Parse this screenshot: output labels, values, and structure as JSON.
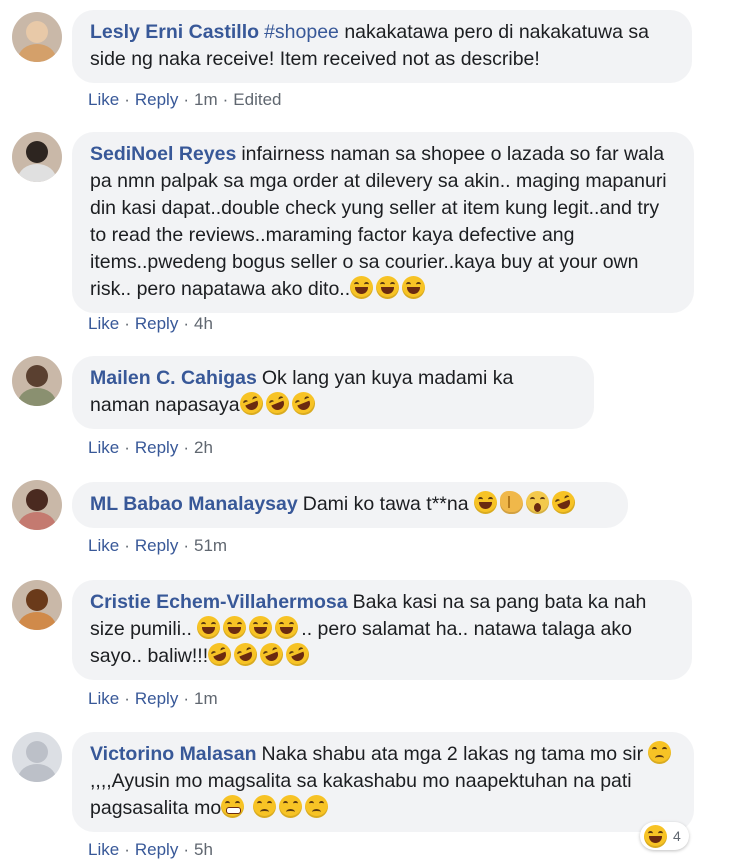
{
  "comments": [
    {
      "author": "Lesly Erni Castillo",
      "hashtag": "#shopee",
      "text": "nakakatawa pero di nakakatuwa sa side ng naka receive! Item received not as describe!",
      "like": "Like",
      "reply": "Reply",
      "time": "1m",
      "edited": "Edited",
      "avatar_colors": [
        "#e8c9a8",
        "#d4a06a",
        "#a87b4f"
      ]
    },
    {
      "author": "SediNoel Reyes",
      "text": "infairness naman sa shopee o lazada so far wala pa nmn palpak sa mga order at dilevery sa akin.. maging mapanuri din kasi dapat..double check yung seller at item kung legit..and try to read the reviews..maraming factor kaya defective ang items..pwedeng bogus seller o sa courier..kaya buy at your own risk.. pero napatawa ako dito..",
      "emojis": [
        "tears-of-joy-emoji",
        "tears-of-joy-emoji",
        "tears-of-joy-emoji"
      ],
      "like": "Like",
      "reply": "Reply",
      "time": "4h",
      "avatar_colors": [
        "#6b7a8a",
        "#2d2520",
        "#e0e0e0"
      ]
    },
    {
      "author": "Mailen C. Cahigas",
      "text": "Ok lang yan kuya madami ka naman napasaya",
      "emojis": [
        "rolling-laughing-emoji",
        "rolling-laughing-emoji",
        "rolling-laughing-emoji"
      ],
      "like": "Like",
      "reply": "Reply",
      "time": "2h",
      "avatar_colors": [
        "#b8b0a0",
        "#5a4030",
        "#8a9070"
      ]
    },
    {
      "author": "ML Babao Manalaysay",
      "text": "Dami ko tawa t**na",
      "emojis": [
        "tears-of-joy-emoji",
        "clapping-hands-emoji",
        "screaming-emoji",
        "rolling-laughing-emoji"
      ],
      "like": "Like",
      "reply": "Reply",
      "time": "51m",
      "avatar_colors": [
        "#d9a7a0",
        "#4a2a20",
        "#c47a70"
      ]
    },
    {
      "author": "Cristie Echem-Villahermosa",
      "text_1": "Baka kasi na sa pang bata ka nah size pumili..",
      "emojis_1": [
        "tears-of-joy-emoji",
        "tears-of-joy-emoji",
        "tears-of-joy-emoji",
        "tears-of-joy-emoji"
      ],
      "text_2": ".. pero salamat ha.. natawa talaga ako sayo.. baliw!!!",
      "emojis_2": [
        "rolling-laughing-emoji",
        "rolling-laughing-emoji",
        "rolling-laughing-emoji",
        "rolling-laughing-emoji"
      ],
      "like": "Like",
      "reply": "Reply",
      "time": "1m",
      "avatar_colors": [
        "#a05a2a",
        "#6a3a1a",
        "#d08a4a"
      ]
    },
    {
      "author": "Victorino Malasan",
      "text_1": "Naka shabu ata mga 2 lakas ng tama mo sir",
      "emojis_1": [
        "sad-face-emoji"
      ],
      "text_2": ",,,,Ayusin mo magsalita sa kakashabu mo naapektuhan na pati pagsasalita mo",
      "emojis_2": [
        "grimacing-emoji",
        "sad-face-emoji",
        "sad-face-emoji",
        "sad-face-emoji"
      ],
      "like": "Like",
      "reply": "Reply",
      "time": "5h",
      "reaction_icon": "haha-reaction-icon",
      "reaction_count": "4",
      "avatar_colors": [
        "#dcdfe4",
        "#bcc0c8",
        "#bcc0c8"
      ]
    }
  ],
  "colors": {
    "author": "#385898",
    "bubble": "#f2f3f5",
    "meta": "#606770"
  }
}
